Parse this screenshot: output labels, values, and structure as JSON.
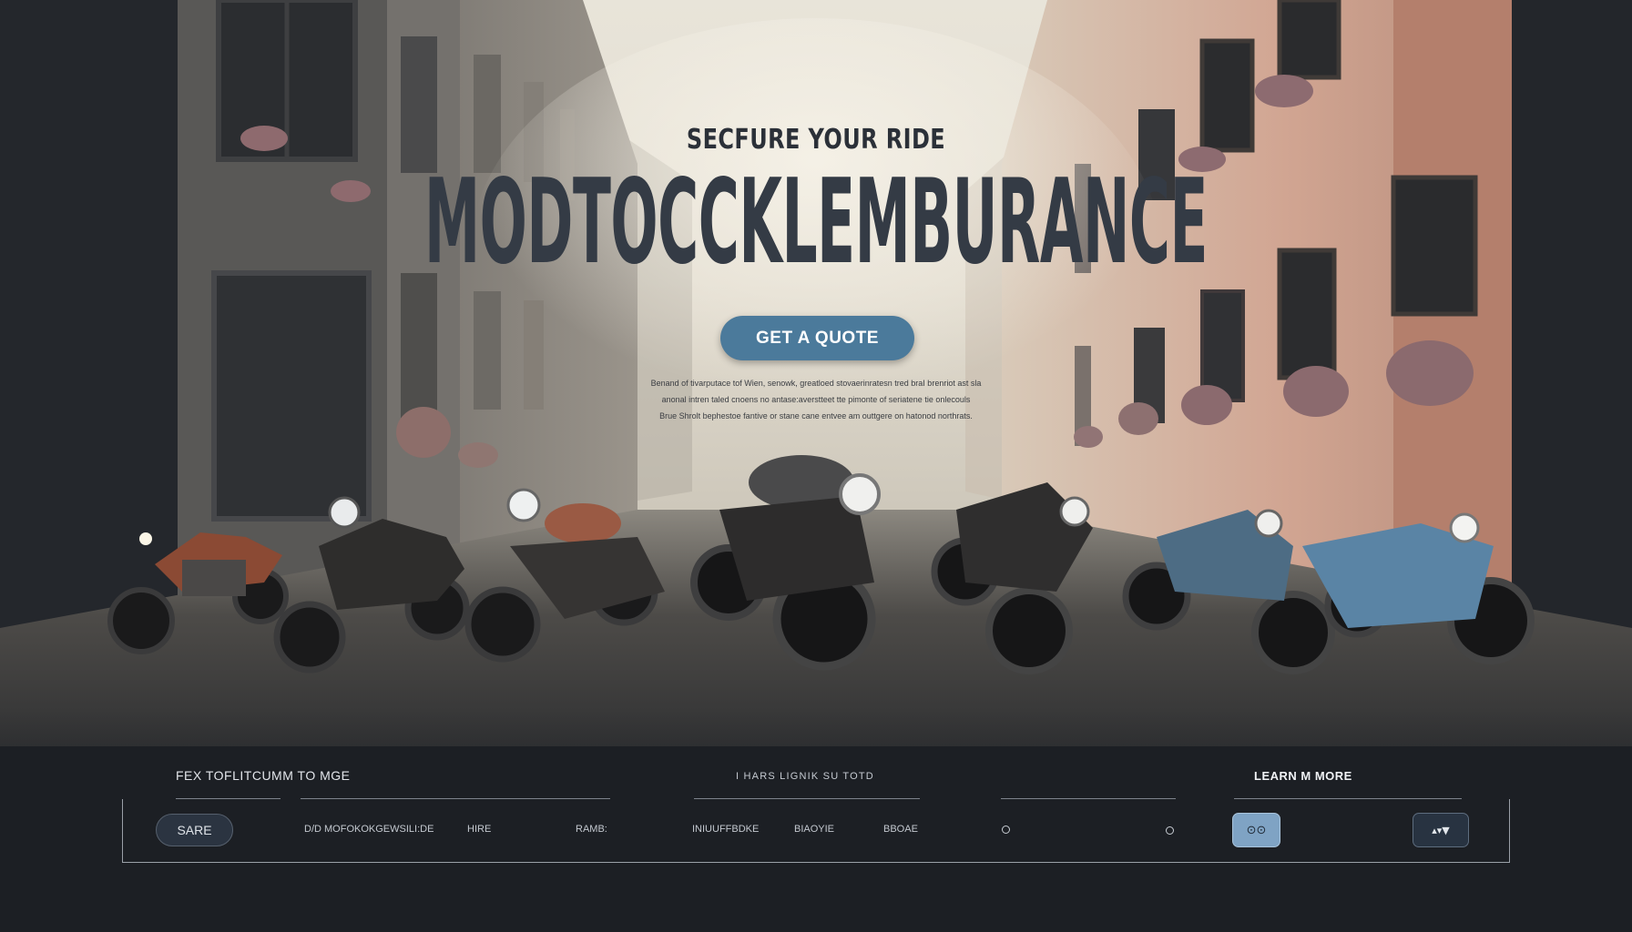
{
  "hero": {
    "tagline": "SECFURE YOUR RIDE",
    "title": "MODTOCCKLEMBURANCE",
    "cta_label": "GET A QUOTE",
    "description": [
      "Benand of tivarputace tof Wien, senowk,  greatloed stovaerinratesn tred braI brenriot ast sla",
      "anonal intren taled cnoens no antase:averstteet tte pimonte of seriatene tie onlecouls",
      "Brue Shrolt bephestoe fantive or stane cane entvee am outtgere on hatonod northrats."
    ]
  },
  "bottom_bar": {
    "heading_left": "FEX TOFLITCUMM TO MGE",
    "heading_center": "I HARS LIGNIK SU TOTD",
    "heading_right": "LEARN M MORE",
    "sare_label": "SARE",
    "links": [
      "D/D  MOFOKOKGEWSILI:DE",
      "HIRE",
      "RAMB:",
      "INIUUFFBDKE",
      "BIAOYIE",
      "BBOAE"
    ],
    "icon_btn_a_glyph": "⊙⊙",
    "icon_btn_b_glyph": "▴▾▼"
  },
  "colors": {
    "accent_button": "#4b7a9b",
    "dark_panel": "#1c1f24",
    "title_text": "#343b45",
    "building_left": "#6d6a66",
    "building_right": "#c5998a"
  }
}
